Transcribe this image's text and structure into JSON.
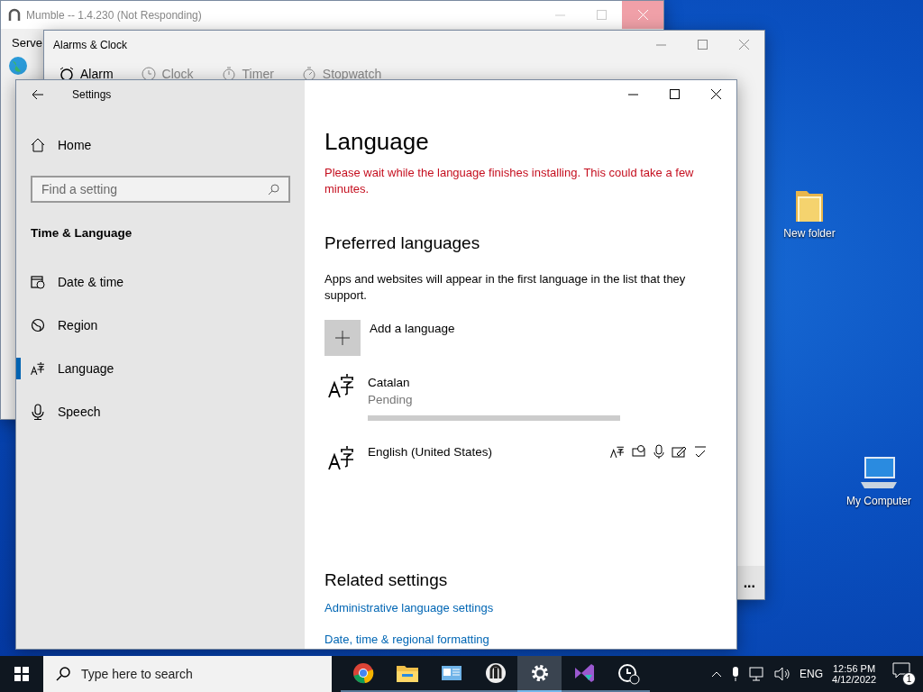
{
  "desktop_icons": [
    {
      "kind": "folder",
      "label": "New folder"
    },
    {
      "kind": "computer",
      "label": "My Computer"
    }
  ],
  "mumble": {
    "title": "Mumble -- 1.4.230 (Not Responding)",
    "menu": "Serve"
  },
  "alarms": {
    "title": "Alarms & Clock",
    "tabs": [
      {
        "kind": "alarm",
        "label": "Alarm",
        "selected": true
      },
      {
        "kind": "clock",
        "label": "Clock",
        "selected": false
      },
      {
        "kind": "timer",
        "label": "Timer",
        "selected": false
      },
      {
        "kind": "stopwatch",
        "label": "Stopwatch",
        "selected": false
      }
    ],
    "more": "..."
  },
  "settings": {
    "title": "Settings",
    "home": "Home",
    "search": {
      "placeholder": "Find a setting"
    },
    "section": "Time & Language",
    "nav": [
      {
        "kind": "datetime",
        "label": "Date & time",
        "selected": false
      },
      {
        "kind": "region",
        "label": "Region",
        "selected": false
      },
      {
        "kind": "language",
        "label": "Language",
        "selected": true
      },
      {
        "kind": "speech",
        "label": "Speech",
        "selected": false
      }
    ],
    "page_title": "Language",
    "warning": "Please wait while the language finishes installing. This could take a few minutes.",
    "preferred_heading": "Preferred languages",
    "preferred_text": "Apps and websites will appear in the first language in the list that they support.",
    "add_language": "Add a language",
    "languages": [
      {
        "name": "Catalan",
        "status": "Pending",
        "level": 1
      },
      {
        "name": "English (United States)"
      }
    ],
    "related_heading": "Related settings",
    "links": [
      "Administrative language settings",
      "Date, time & regional formatting"
    ]
  },
  "taskbar": {
    "search": {
      "placeholder": "Type here to search"
    },
    "apps": [
      {
        "kind": "chrome",
        "selected": false
      },
      {
        "kind": "explorer",
        "selected": false
      },
      {
        "kind": "panel",
        "selected": false
      },
      {
        "kind": "mumble",
        "selected": false
      },
      {
        "kind": "settings",
        "selected": true
      },
      {
        "kind": "studio",
        "selected": false
      },
      {
        "kind": "alarms",
        "selected": false
      }
    ],
    "language": "ENG",
    "time": "12:56 PM",
    "date": "4/12/2022",
    "notifications": "1"
  }
}
